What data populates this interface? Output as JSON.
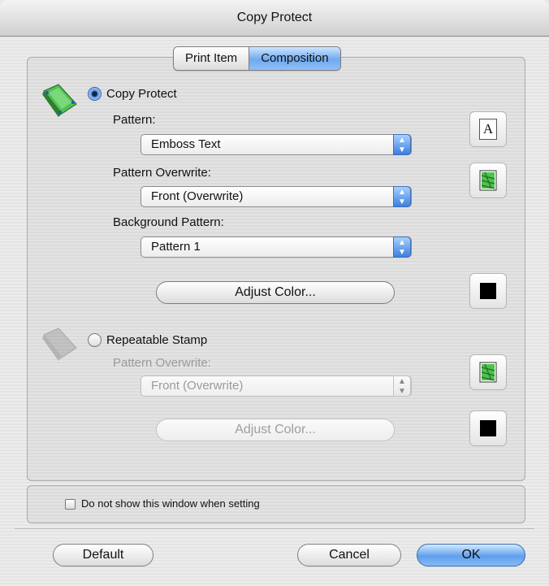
{
  "window": {
    "title": "Copy Protect"
  },
  "tabs": [
    {
      "label": "Print Item",
      "active": false
    },
    {
      "label": "Composition",
      "active": true
    }
  ],
  "copy_protect": {
    "radio_label": "Copy Protect",
    "selected": true,
    "pattern": {
      "label": "Pattern:",
      "value": "Emboss Text"
    },
    "pattern_overwrite": {
      "label": "Pattern Overwrite:",
      "value": "Front (Overwrite)"
    },
    "background_pattern": {
      "label": "Background Pattern:",
      "value": "Pattern 1"
    },
    "adjust_color_label": "Adjust Color...",
    "font_button_glyph": "A"
  },
  "repeatable_stamp": {
    "radio_label": "Repeatable Stamp",
    "selected": false,
    "pattern_overwrite": {
      "label": "Pattern Overwrite:",
      "value": "Front (Overwrite)"
    },
    "adjust_color_label": "Adjust Color..."
  },
  "footer": {
    "checkbox_label": "Do not show this window when setting",
    "checked": false
  },
  "buttons": {
    "default_label": "Default",
    "cancel_label": "Cancel",
    "ok_label": "OK"
  },
  "colors": {
    "accent": "#5f9fec",
    "swatch": "#000000",
    "pattern_icon_green": "#4fc14f"
  }
}
